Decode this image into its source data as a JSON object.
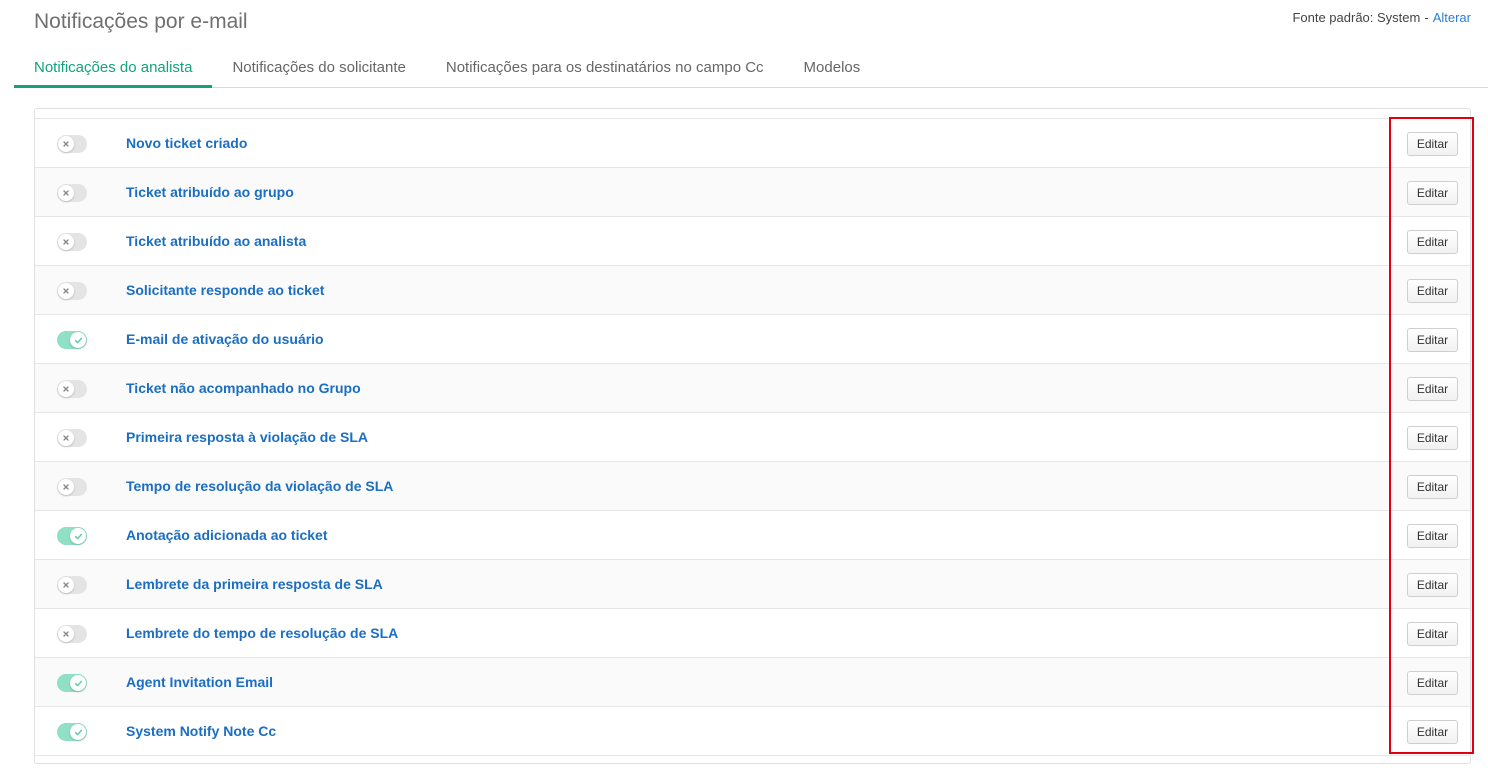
{
  "page": {
    "title": "Notificações por e-mail",
    "font_label": "Fonte padrão: System",
    "separator": "-",
    "change_link": "Alterar"
  },
  "tabs": [
    {
      "label": "Notificações do analista",
      "active": true
    },
    {
      "label": "Notificações do solicitante",
      "active": false
    },
    {
      "label": "Notificações para os destinatários no campo Cc",
      "active": false
    },
    {
      "label": "Modelos",
      "active": false
    }
  ],
  "edit_label": "Editar",
  "colors": {
    "accent": "#12a37e",
    "link": "#1b6ec1",
    "toggle_on": "#8fe0c4",
    "toggle_off": "#e4e4e4",
    "highlight": "#e0000f"
  },
  "notifications": [
    {
      "label": "Novo ticket criado",
      "enabled": false
    },
    {
      "label": "Ticket atribuído ao grupo",
      "enabled": false
    },
    {
      "label": "Ticket atribuído ao analista",
      "enabled": false
    },
    {
      "label": "Solicitante responde ao ticket",
      "enabled": false
    },
    {
      "label": "E-mail de ativação do usuário",
      "enabled": true
    },
    {
      "label": "Ticket não acompanhado no Grupo",
      "enabled": false
    },
    {
      "label": "Primeira resposta à violação de SLA",
      "enabled": false
    },
    {
      "label": "Tempo de resolução da violação de SLA",
      "enabled": false
    },
    {
      "label": "Anotação adicionada ao ticket",
      "enabled": true
    },
    {
      "label": "Lembrete da primeira resposta de SLA",
      "enabled": false
    },
    {
      "label": "Lembrete do tempo de resolução de SLA",
      "enabled": false
    },
    {
      "label": "Agent Invitation Email",
      "enabled": true
    },
    {
      "label": "System Notify Note Cc",
      "enabled": true
    }
  ]
}
